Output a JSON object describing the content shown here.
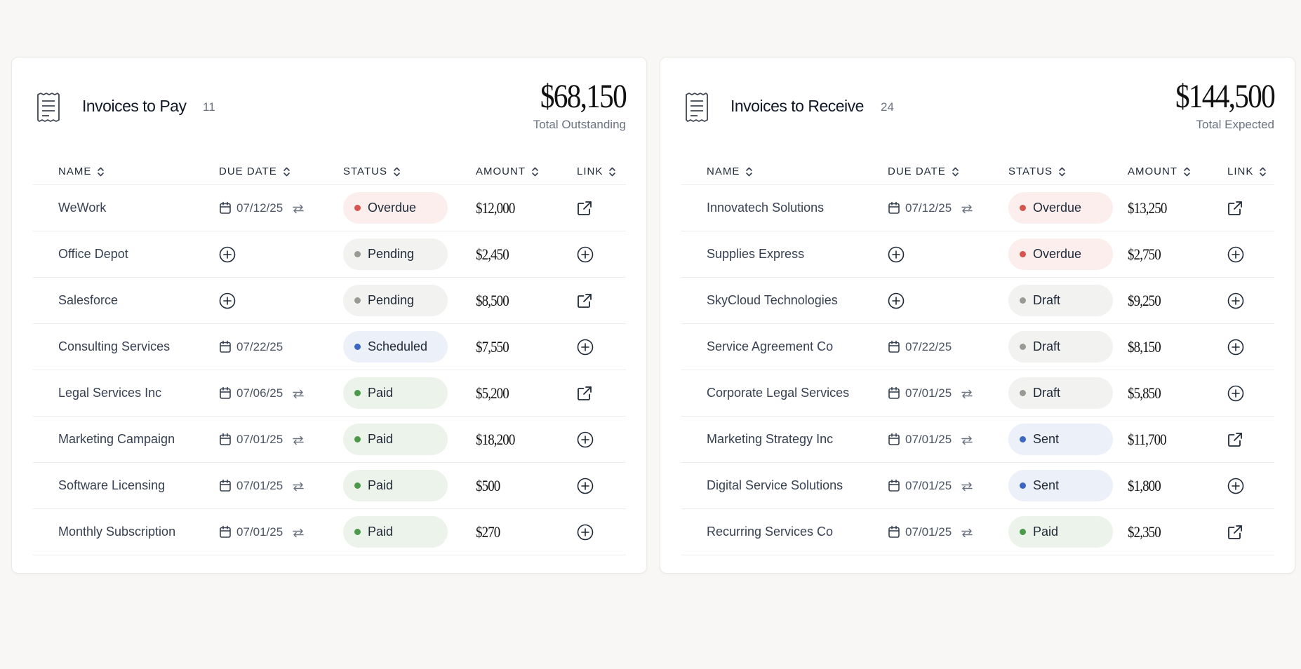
{
  "colors": {
    "overdue_bg": "#fbeeec",
    "overdue_dot": "#d9534f",
    "pending_bg": "#f2f2f1",
    "pending_dot": "#9a9a94",
    "draft_bg": "#f2f2f1",
    "draft_dot": "#9a9a94",
    "scheduled_bg": "#ecf0f8",
    "scheduled_dot": "#3b66c4",
    "sent_bg": "#ecf0f8",
    "sent_dot": "#3b66c4",
    "paid_bg": "#ecf3ea",
    "paid_dot": "#4a9a4a"
  },
  "columns": {
    "name": "NAME",
    "due_date": "DUE DATE",
    "status": "STATUS",
    "amount": "AMOUNT",
    "link": "LINK"
  },
  "pay": {
    "title": "Invoices to Pay",
    "count": "11",
    "total": "$68,150",
    "total_label": "Total Outstanding",
    "rows": [
      {
        "name": "WeWork",
        "date": "07/12/25",
        "recurring": true,
        "status": "Overdue",
        "status_key": "overdue",
        "amount": "$12,000",
        "link": "external"
      },
      {
        "name": "Office Depot",
        "date": "",
        "recurring": false,
        "status": "Pending",
        "status_key": "pending",
        "amount": "$2,450",
        "link": "add"
      },
      {
        "name": "Salesforce",
        "date": "",
        "recurring": false,
        "status": "Pending",
        "status_key": "pending",
        "amount": "$8,500",
        "link": "external"
      },
      {
        "name": "Consulting Services",
        "date": "07/22/25",
        "recurring": false,
        "status": "Scheduled",
        "status_key": "scheduled",
        "amount": "$7,550",
        "link": "add"
      },
      {
        "name": "Legal Services Inc",
        "date": "07/06/25",
        "recurring": true,
        "status": "Paid",
        "status_key": "paid",
        "amount": "$5,200",
        "link": "external"
      },
      {
        "name": "Marketing Campaign",
        "date": "07/01/25",
        "recurring": true,
        "status": "Paid",
        "status_key": "paid",
        "amount": "$18,200",
        "link": "add"
      },
      {
        "name": "Software Licensing",
        "date": "07/01/25",
        "recurring": true,
        "status": "Paid",
        "status_key": "paid",
        "amount": "$500",
        "link": "add"
      },
      {
        "name": "Monthly Subscription",
        "date": "07/01/25",
        "recurring": true,
        "status": "Paid",
        "status_key": "paid",
        "amount": "$270",
        "link": "add"
      }
    ]
  },
  "receive": {
    "title": "Invoices to Receive",
    "count": "24",
    "total": "$144,500",
    "total_label": "Total Expected",
    "rows": [
      {
        "name": "Innovatech Solutions",
        "date": "07/12/25",
        "recurring": true,
        "status": "Overdue",
        "status_key": "overdue",
        "amount": "$13,250",
        "link": "external"
      },
      {
        "name": "Supplies Express",
        "date": "",
        "recurring": false,
        "status": "Overdue",
        "status_key": "overdue",
        "amount": "$2,750",
        "link": "add"
      },
      {
        "name": "SkyCloud Technologies",
        "date": "",
        "recurring": false,
        "status": "Draft",
        "status_key": "draft",
        "amount": "$9,250",
        "link": "add"
      },
      {
        "name": "Service Agreement Co",
        "date": "07/22/25",
        "recurring": false,
        "status": "Draft",
        "status_key": "draft",
        "amount": "$8,150",
        "link": "add"
      },
      {
        "name": "Corporate Legal Services",
        "date": "07/01/25",
        "recurring": true,
        "status": "Draft",
        "status_key": "draft",
        "amount": "$5,850",
        "link": "add"
      },
      {
        "name": "Marketing Strategy Inc",
        "date": "07/01/25",
        "recurring": true,
        "status": "Sent",
        "status_key": "sent",
        "amount": "$11,700",
        "link": "external"
      },
      {
        "name": "Digital Service Solutions",
        "date": "07/01/25",
        "recurring": true,
        "status": "Sent",
        "status_key": "sent",
        "amount": "$1,800",
        "link": "add"
      },
      {
        "name": "Recurring Services Co",
        "date": "07/01/25",
        "recurring": true,
        "status": "Paid",
        "status_key": "paid",
        "amount": "$2,350",
        "link": "external"
      }
    ]
  }
}
